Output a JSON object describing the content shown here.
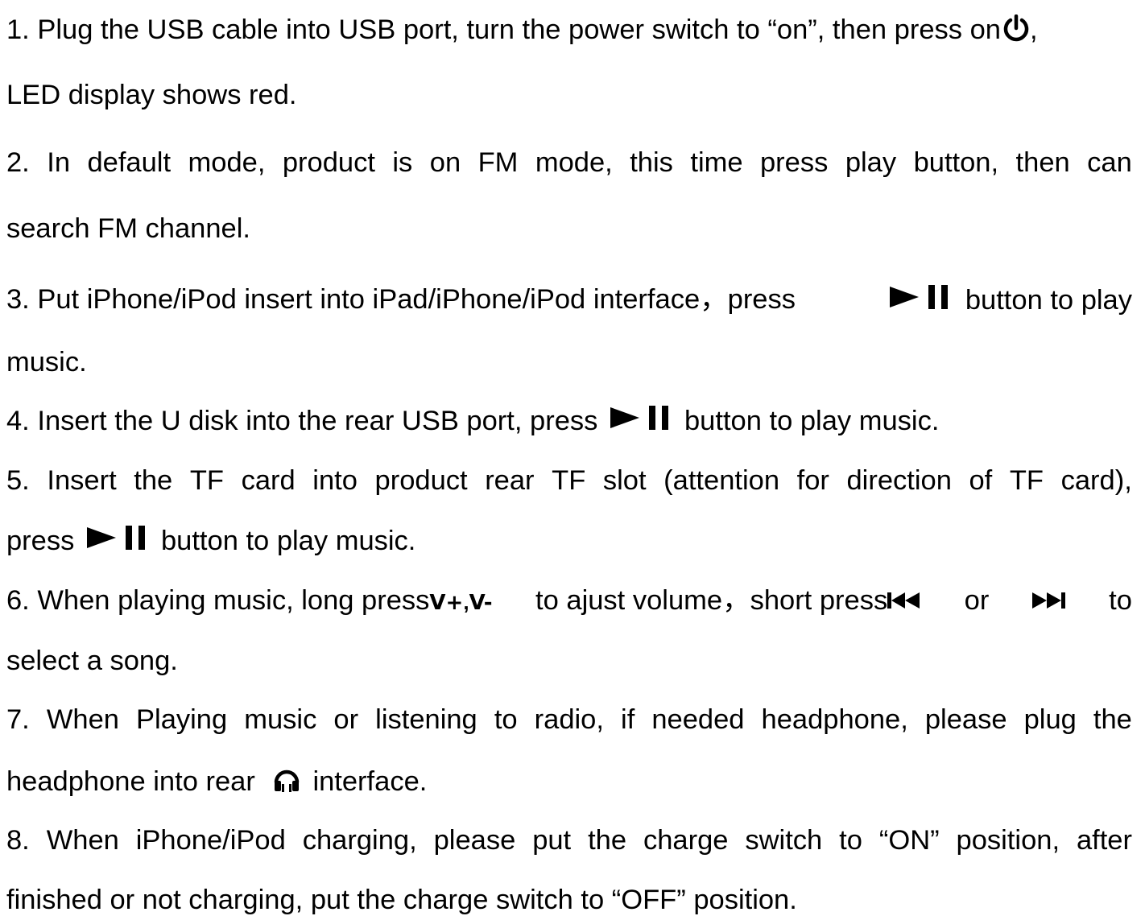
{
  "document": {
    "item1": {
      "line_a": "1. Plug the USB cable into USB port, turn the power switch to “on”, then press on",
      "line_a_end": ",",
      "line_b": "LED display shows red."
    },
    "item2": {
      "line_a": "2. In default mode, product is on FM mode, this time press play button, then can",
      "line_b": "search FM channel."
    },
    "item3": {
      "line_a_pre": "3. Put iPhone/iPod insert into iPad/iPhone/iPod interface，press",
      "line_a_post": "button to play",
      "line_b": "music."
    },
    "item4": {
      "line_a_pre": "4. Insert the U disk into the rear USB port, press",
      "line_a_post": "button to play music."
    },
    "item5": {
      "line_a": "5. Insert the TF card into product rear TF slot (attention for direction of TF card),",
      "line_b_pre": "press",
      "line_b_post": "button to play music."
    },
    "item6": {
      "line_a_pre": "6. When playing music, long press",
      "vol_up": "V+",
      "comma": ",",
      "vol_down": "V-",
      "line_a_mid": "to ajust volume，short press",
      "or": "or",
      "to": "to",
      "line_b": "select a song."
    },
    "item7": {
      "line_a": "7. When Playing music or listening to radio, if needed headphone, please plug the",
      "line_b_pre": "headphone into rear",
      "line_b_post": "interface."
    },
    "item8": {
      "line_a": "8. When iPhone/iPod charging, please put the charge switch to “ON” position, after",
      "line_b": "finished or not charging, put the charge switch to “OFF” position."
    }
  },
  "icons": {
    "power": "power-icon",
    "play_pause": "play-pause-icon",
    "prev": "previous-track-icon",
    "next": "next-track-icon",
    "headphone": "headphone-icon"
  }
}
